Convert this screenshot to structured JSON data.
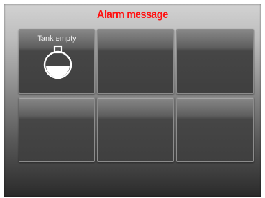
{
  "header": {
    "title": "Alarm message"
  },
  "colors": {
    "title": "#ff1010",
    "tile": "#474747"
  },
  "tiles": [
    {
      "label": "Tank empty",
      "icon": "tank-empty-icon"
    },
    {
      "label": ""
    },
    {
      "label": ""
    },
    {
      "label": ""
    },
    {
      "label": ""
    },
    {
      "label": ""
    }
  ]
}
